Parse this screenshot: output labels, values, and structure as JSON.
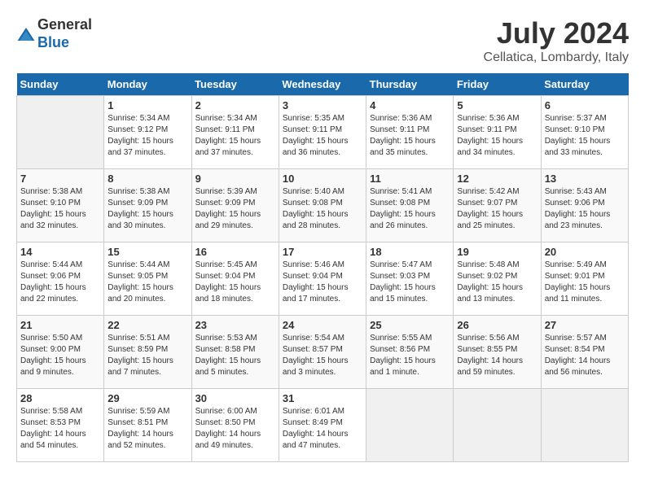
{
  "header": {
    "logo_general": "General",
    "logo_blue": "Blue",
    "month_year": "July 2024",
    "location": "Cellatica, Lombardy, Italy"
  },
  "calendar": {
    "days_of_week": [
      "Sunday",
      "Monday",
      "Tuesday",
      "Wednesday",
      "Thursday",
      "Friday",
      "Saturday"
    ],
    "weeks": [
      [
        {
          "day": "",
          "info": ""
        },
        {
          "day": "1",
          "info": "Sunrise: 5:34 AM\nSunset: 9:12 PM\nDaylight: 15 hours\nand 37 minutes."
        },
        {
          "day": "2",
          "info": "Sunrise: 5:34 AM\nSunset: 9:11 PM\nDaylight: 15 hours\nand 37 minutes."
        },
        {
          "day": "3",
          "info": "Sunrise: 5:35 AM\nSunset: 9:11 PM\nDaylight: 15 hours\nand 36 minutes."
        },
        {
          "day": "4",
          "info": "Sunrise: 5:36 AM\nSunset: 9:11 PM\nDaylight: 15 hours\nand 35 minutes."
        },
        {
          "day": "5",
          "info": "Sunrise: 5:36 AM\nSunset: 9:11 PM\nDaylight: 15 hours\nand 34 minutes."
        },
        {
          "day": "6",
          "info": "Sunrise: 5:37 AM\nSunset: 9:10 PM\nDaylight: 15 hours\nand 33 minutes."
        }
      ],
      [
        {
          "day": "7",
          "info": "Sunrise: 5:38 AM\nSunset: 9:10 PM\nDaylight: 15 hours\nand 32 minutes."
        },
        {
          "day": "8",
          "info": "Sunrise: 5:38 AM\nSunset: 9:09 PM\nDaylight: 15 hours\nand 30 minutes."
        },
        {
          "day": "9",
          "info": "Sunrise: 5:39 AM\nSunset: 9:09 PM\nDaylight: 15 hours\nand 29 minutes."
        },
        {
          "day": "10",
          "info": "Sunrise: 5:40 AM\nSunset: 9:08 PM\nDaylight: 15 hours\nand 28 minutes."
        },
        {
          "day": "11",
          "info": "Sunrise: 5:41 AM\nSunset: 9:08 PM\nDaylight: 15 hours\nand 26 minutes."
        },
        {
          "day": "12",
          "info": "Sunrise: 5:42 AM\nSunset: 9:07 PM\nDaylight: 15 hours\nand 25 minutes."
        },
        {
          "day": "13",
          "info": "Sunrise: 5:43 AM\nSunset: 9:06 PM\nDaylight: 15 hours\nand 23 minutes."
        }
      ],
      [
        {
          "day": "14",
          "info": "Sunrise: 5:44 AM\nSunset: 9:06 PM\nDaylight: 15 hours\nand 22 minutes."
        },
        {
          "day": "15",
          "info": "Sunrise: 5:44 AM\nSunset: 9:05 PM\nDaylight: 15 hours\nand 20 minutes."
        },
        {
          "day": "16",
          "info": "Sunrise: 5:45 AM\nSunset: 9:04 PM\nDaylight: 15 hours\nand 18 minutes."
        },
        {
          "day": "17",
          "info": "Sunrise: 5:46 AM\nSunset: 9:04 PM\nDaylight: 15 hours\nand 17 minutes."
        },
        {
          "day": "18",
          "info": "Sunrise: 5:47 AM\nSunset: 9:03 PM\nDaylight: 15 hours\nand 15 minutes."
        },
        {
          "day": "19",
          "info": "Sunrise: 5:48 AM\nSunset: 9:02 PM\nDaylight: 15 hours\nand 13 minutes."
        },
        {
          "day": "20",
          "info": "Sunrise: 5:49 AM\nSunset: 9:01 PM\nDaylight: 15 hours\nand 11 minutes."
        }
      ],
      [
        {
          "day": "21",
          "info": "Sunrise: 5:50 AM\nSunset: 9:00 PM\nDaylight: 15 hours\nand 9 minutes."
        },
        {
          "day": "22",
          "info": "Sunrise: 5:51 AM\nSunset: 8:59 PM\nDaylight: 15 hours\nand 7 minutes."
        },
        {
          "day": "23",
          "info": "Sunrise: 5:53 AM\nSunset: 8:58 PM\nDaylight: 15 hours\nand 5 minutes."
        },
        {
          "day": "24",
          "info": "Sunrise: 5:54 AM\nSunset: 8:57 PM\nDaylight: 15 hours\nand 3 minutes."
        },
        {
          "day": "25",
          "info": "Sunrise: 5:55 AM\nSunset: 8:56 PM\nDaylight: 15 hours\nand 1 minute."
        },
        {
          "day": "26",
          "info": "Sunrise: 5:56 AM\nSunset: 8:55 PM\nDaylight: 14 hours\nand 59 minutes."
        },
        {
          "day": "27",
          "info": "Sunrise: 5:57 AM\nSunset: 8:54 PM\nDaylight: 14 hours\nand 56 minutes."
        }
      ],
      [
        {
          "day": "28",
          "info": "Sunrise: 5:58 AM\nSunset: 8:53 PM\nDaylight: 14 hours\nand 54 minutes."
        },
        {
          "day": "29",
          "info": "Sunrise: 5:59 AM\nSunset: 8:51 PM\nDaylight: 14 hours\nand 52 minutes."
        },
        {
          "day": "30",
          "info": "Sunrise: 6:00 AM\nSunset: 8:50 PM\nDaylight: 14 hours\nand 49 minutes."
        },
        {
          "day": "31",
          "info": "Sunrise: 6:01 AM\nSunset: 8:49 PM\nDaylight: 14 hours\nand 47 minutes."
        },
        {
          "day": "",
          "info": ""
        },
        {
          "day": "",
          "info": ""
        },
        {
          "day": "",
          "info": ""
        }
      ]
    ]
  }
}
